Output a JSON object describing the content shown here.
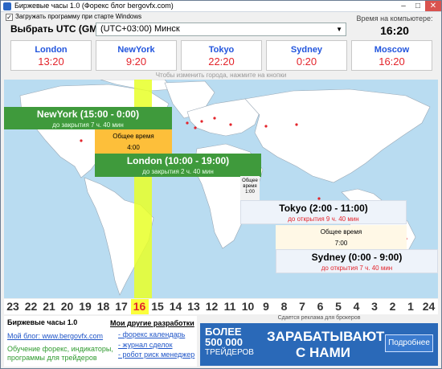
{
  "window": {
    "title": "Биржевые часы 1.0 (Форекс блог bergovfx.com)"
  },
  "controls": {
    "min": "–",
    "max": "□",
    "close": "✕"
  },
  "autostart": {
    "label": "Загружать программу при старте Windows",
    "check": "✓"
  },
  "utc": {
    "label": "Выбрать UTC (GMT):",
    "value": "(UTC+03:00) Минск",
    "arrow": "▼"
  },
  "computer_time": {
    "label": "Время на компьютере:",
    "value": "16:20"
  },
  "cities": [
    {
      "name": "London",
      "time": "13:20"
    },
    {
      "name": "NewYork",
      "time": "9:20"
    },
    {
      "name": "Tokyo",
      "time": "22:20"
    },
    {
      "name": "Sydney",
      "time": "0:20"
    },
    {
      "name": "Moscow",
      "time": "16:20"
    }
  ],
  "city_hint": "Чтобы изменить города, нажмите на кнопки",
  "sessions": {
    "newyork": {
      "title": "NewYork (15:00 - 0:00)",
      "sub": "до закрытия 7 ч. 40 мин"
    },
    "london": {
      "title": "London (10:00 - 19:00)",
      "sub": "до закрытия 2 ч. 40 мин"
    },
    "tokyo": {
      "title": "Tokyo (2:00 - 11:00)",
      "sub": "до открытия 9 ч. 40 мин"
    },
    "sydney": {
      "title": "Sydney (0:00 - 9:00)",
      "sub": "до открытия 7 ч. 40 мин"
    }
  },
  "overlaps": {
    "ny_london": {
      "label": "Общее время",
      "time": "4:00"
    },
    "london_tokyo": {
      "l1": "Общее",
      "l2": "время",
      "time": "1:00"
    },
    "tokyo_sydney": {
      "label": "Общее время",
      "time": "7:00"
    }
  },
  "hours": [
    "23",
    "22",
    "21",
    "20",
    "19",
    "18",
    "17",
    "16",
    "15",
    "14",
    "13",
    "12",
    "11",
    "10",
    "9",
    "8",
    "7",
    "6",
    "5",
    "4",
    "3",
    "2",
    "1",
    "24"
  ],
  "current_hour": "16",
  "footer": {
    "brand_title": "Биржевые часы 1.0",
    "blog_link": "Мой блог: www.bergovfx.com",
    "desc": "Обучение форекс, индикаторы, программы для трейдеров",
    "other_title": "Мои другие разработки",
    "other_links": [
      "- форекс календарь",
      "- журнал сделок",
      "- робот риск менеджер"
    ]
  },
  "ad": {
    "caption": "Сдается реклама для брокеров",
    "big": "БОЛЕЕ",
    "number": "500 000",
    "small": "ТРЕЙДЕРОВ",
    "main": "ЗАРАБАТЫВАЮТ С НАМИ",
    "button": "Подробнее"
  }
}
